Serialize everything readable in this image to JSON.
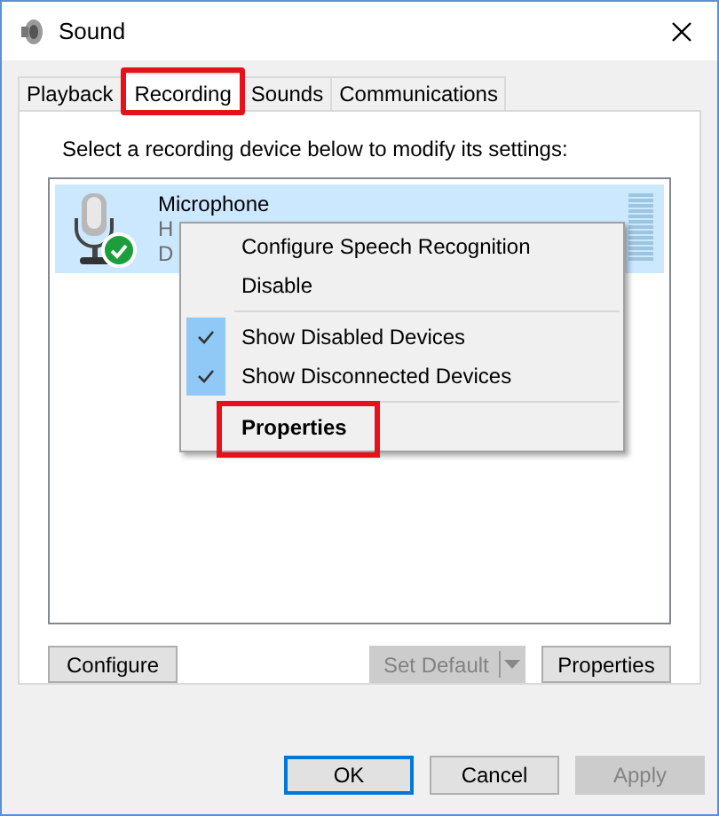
{
  "window": {
    "title": "Sound"
  },
  "tabs": [
    {
      "label": "Playback",
      "selected": false,
      "highlighted": false
    },
    {
      "label": "Recording",
      "selected": true,
      "highlighted": true
    },
    {
      "label": "Sounds",
      "selected": false,
      "highlighted": false
    },
    {
      "label": "Communications",
      "selected": false,
      "highlighted": false
    }
  ],
  "instruction": "Select a recording device below to modify its settings:",
  "devices": [
    {
      "name": "Microphone",
      "line_2": "H",
      "line_3": "D",
      "selected": true,
      "default": true
    }
  ],
  "context_menu": [
    {
      "kind": "item",
      "label": "Configure Speech Recognition",
      "checked": false,
      "bold": false,
      "highlighted": false
    },
    {
      "kind": "item",
      "label": "Disable",
      "checked": false,
      "bold": false,
      "highlighted": false
    },
    {
      "kind": "separator"
    },
    {
      "kind": "item",
      "label": "Show Disabled Devices",
      "checked": true,
      "bold": false,
      "highlighted": false
    },
    {
      "kind": "item",
      "label": "Show Disconnected Devices",
      "checked": true,
      "bold": false,
      "highlighted": false
    },
    {
      "kind": "separator"
    },
    {
      "kind": "item",
      "label": "Properties",
      "checked": false,
      "bold": true,
      "highlighted": true
    }
  ],
  "device_buttons": [
    {
      "kind": "button",
      "label": "Configure",
      "disabled": false
    },
    {
      "kind": "split",
      "label": "Set Default",
      "disabled": true
    },
    {
      "kind": "button",
      "label": "Properties",
      "disabled": false
    }
  ],
  "dialog_buttons": [
    {
      "label": "OK",
      "disabled": false,
      "default": true
    },
    {
      "label": "Cancel",
      "disabled": false,
      "default": false
    },
    {
      "label": "Apply",
      "disabled": true,
      "default": false
    }
  ]
}
